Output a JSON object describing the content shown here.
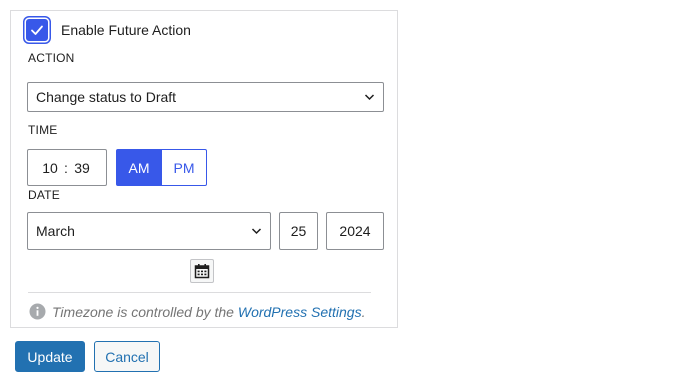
{
  "enable": {
    "checked": true,
    "label": "Enable Future Action"
  },
  "action": {
    "label": "ACTION",
    "selected": "Change status to Draft"
  },
  "time": {
    "label": "TIME",
    "hour": "10",
    "separator": ":",
    "minute": "39",
    "am_label": "AM",
    "pm_label": "PM",
    "period_selected": "AM"
  },
  "date": {
    "label": "DATE",
    "month": "March",
    "day": "25",
    "year": "2024"
  },
  "timezone": {
    "text_before": "Timezone is controlled by the",
    "link_text": "WordPress Settings",
    "text_after": "."
  },
  "buttons": {
    "update": "Update",
    "cancel": "Cancel"
  },
  "icons": {
    "checkbox": "checkmark-icon",
    "dropdown": "chevron-down-icon",
    "calendar": "calendar-icon",
    "info": "info-icon"
  },
  "colors": {
    "accent": "#3858e9",
    "primary_button": "#2271b1",
    "link": "#2271b1"
  }
}
